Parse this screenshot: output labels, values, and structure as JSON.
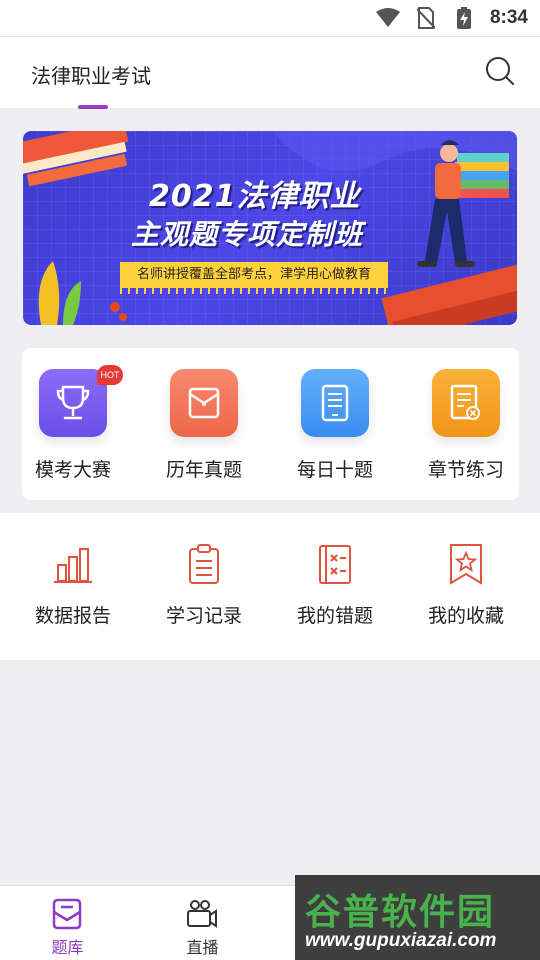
{
  "status_bar": {
    "time": "8:34"
  },
  "header": {
    "title": "法律职业考试"
  },
  "banner": {
    "line1": "2021法律职业",
    "line2": "主观题专项定制班",
    "tagline": "名师讲授覆盖全部考点，津学用心做教育"
  },
  "grid": [
    {
      "label": "模考大赛",
      "color": "#7b5cf0",
      "badge": "HOT"
    },
    {
      "label": "历年真题",
      "color": "#f27760"
    },
    {
      "label": "每日十题",
      "color": "#4a9df5"
    },
    {
      "label": "章节练习",
      "color": "#f5a623"
    }
  ],
  "tools": [
    {
      "label": "数据报告"
    },
    {
      "label": "学习记录"
    },
    {
      "label": "我的错题"
    },
    {
      "label": "我的收藏"
    }
  ],
  "nav": [
    {
      "label": "题库"
    },
    {
      "label": "直播"
    }
  ],
  "watermark": {
    "line1": "谷普软件园",
    "line2": "www.gupuxiazai.com"
  },
  "colors": {
    "accent": "#9c3dc8",
    "tool_icon": "#e0533f"
  }
}
